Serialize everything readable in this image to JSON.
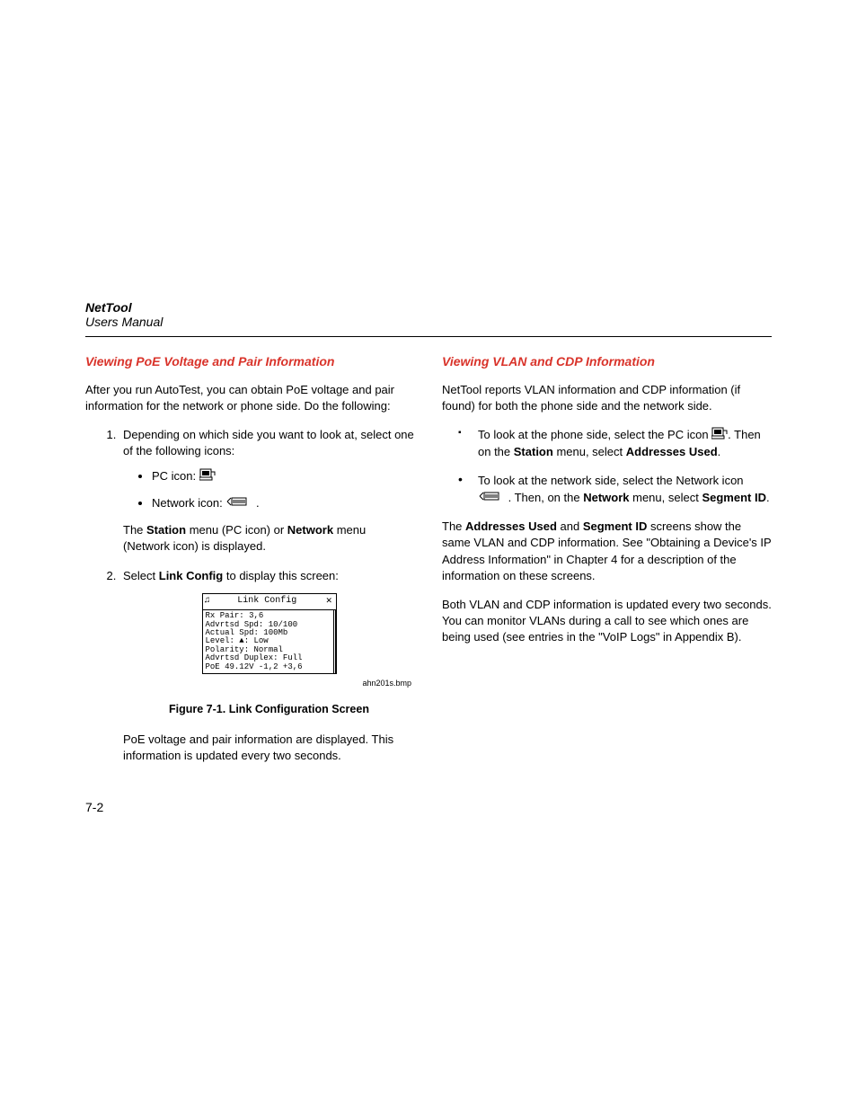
{
  "header": {
    "title": "NetTool",
    "subtitle": "Users Manual"
  },
  "left": {
    "heading": "Viewing PoE Voltage and Pair Information",
    "intro": "After you run AutoTest, you can obtain PoE voltage and pair information for the network or phone side. Do the following:",
    "step1": "Depending on which side you want to look at, select one of the following icons:",
    "icon_pc_label": "PC icon:",
    "icon_net_label": "Network icon:",
    "step1_after_pre": "The ",
    "station": "Station",
    "step1_mid1": " menu (PC icon) or ",
    "network": "Network",
    "step1_after_post": " menu (Network icon) is displayed.",
    "step2_pre": "Select ",
    "linkconfig": "Link Config",
    "step2_post": " to display this screen:",
    "screenshot": {
      "title": "Link Config",
      "lines": "Rx Pair: 3,6\nAdvrtsd Spd: 10/100\nActual Spd: 100Mb\nLevel: ▲: Low\nPolarity: Normal\nAdvrtsd Duplex: Full\nPoE 49.12V -1,2 +3,6"
    },
    "bmp_label": "ahn201s.bmp",
    "fig_caption": "Figure 7-1. Link Configuration Screen",
    "outro": "PoE voltage and pair information are displayed. This information is updated every two seconds."
  },
  "right": {
    "heading": "Viewing VLAN and CDP Information",
    "intro": "NetTool reports VLAN information and CDP information (if found) for both the phone side and the network side.",
    "b1_pre": "To look at the phone side, select the PC icon ",
    "b1_mid": ". Then on the ",
    "station": "Station",
    "b1_mid2": " menu, select ",
    "addr_used": "Addresses Used",
    "period": ".",
    "b2_pre": "To look at the network side, select the Network icon ",
    "b2_mid": " . Then, on the ",
    "network": "Network",
    "b2_mid2": " menu, select ",
    "segment_id": "Segment ID",
    "p2_pre": "The ",
    "p2_mid1": " and ",
    "p2_mid2": " screens show the same VLAN and CDP information. See \"Obtaining a Device's IP Address Information\" in Chapter 4 for a description of the information on these screens.",
    "p3": "Both VLAN and CDP information is updated every two seconds. You can monitor VLANs during a call to see which ones are being used (see entries in the \"VoIP Logs\" in Appendix B)."
  },
  "page_number": "7-2"
}
